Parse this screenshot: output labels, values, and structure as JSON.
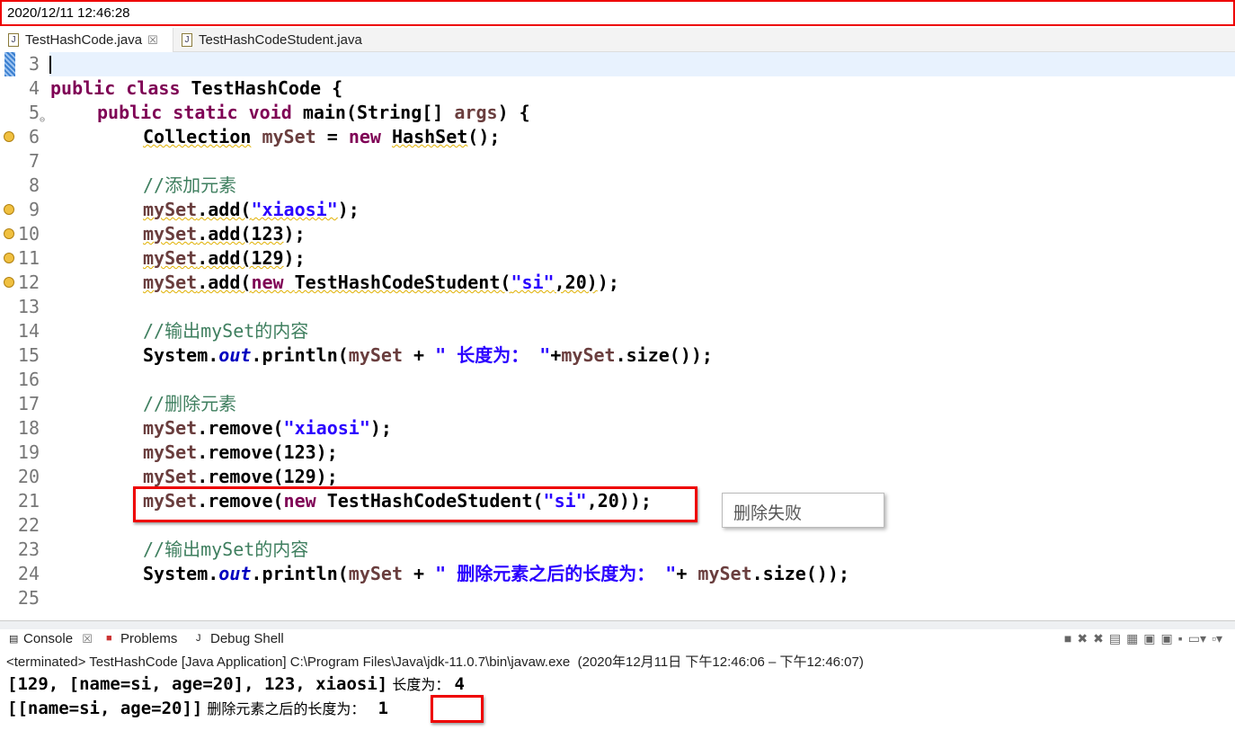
{
  "timestamp": "2020/12/11 12:46:28",
  "editor_tabs": [
    {
      "label": "TestHashCode.java",
      "close": "☒"
    },
    {
      "label": "TestHashCodeStudent.java"
    }
  ],
  "code_lines": [
    {
      "n": "3",
      "indent": 0,
      "tokens": []
    },
    {
      "n": "4",
      "indent": 0,
      "tokens": [
        [
          "kw",
          "public "
        ],
        [
          "kw",
          "class "
        ],
        [
          "pl",
          "TestHashCode {"
        ]
      ]
    },
    {
      "n": "5",
      "indent": 1,
      "fold": true,
      "tokens": [
        [
          "kw",
          "public "
        ],
        [
          "kw",
          "static "
        ],
        [
          "kw",
          "void "
        ],
        [
          "pl",
          "main(String[] "
        ],
        [
          "lv",
          "args"
        ],
        [
          "pl",
          ") {"
        ]
      ]
    },
    {
      "n": "6",
      "indent": 2,
      "warn": true,
      "tokens": [
        [
          "pl wavy",
          "Collection"
        ],
        [
          "pl",
          " "
        ],
        [
          "lv",
          "mySet"
        ],
        [
          "pl",
          " = "
        ],
        [
          "kw",
          "new "
        ],
        [
          "pl wavy",
          "HashSet"
        ],
        [
          "pl",
          "();"
        ]
      ]
    },
    {
      "n": "7",
      "indent": 0,
      "tokens": []
    },
    {
      "n": "8",
      "indent": 2,
      "tokens": [
        [
          "cm",
          "//添加元素"
        ]
      ]
    },
    {
      "n": "9",
      "indent": 2,
      "warn": true,
      "tokens": [
        [
          "lv wavy",
          "mySet"
        ],
        [
          "pl wavy",
          ".add("
        ],
        [
          "str wavy",
          "\"xiaosi\""
        ],
        [
          "pl",
          ");"
        ]
      ]
    },
    {
      "n": "10",
      "indent": 2,
      "warn": true,
      "tokens": [
        [
          "lv wavy",
          "mySet"
        ],
        [
          "pl wavy",
          ".add(123"
        ],
        [
          "pl",
          ");"
        ]
      ]
    },
    {
      "n": "11",
      "indent": 2,
      "warn": true,
      "tokens": [
        [
          "lv wavy",
          "mySet"
        ],
        [
          "pl wavy",
          ".add(129"
        ],
        [
          "pl",
          ");"
        ]
      ]
    },
    {
      "n": "12",
      "indent": 2,
      "warn": true,
      "tokens": [
        [
          "lv wavy",
          "mySet"
        ],
        [
          "pl wavy",
          ".add("
        ],
        [
          "kw wavy",
          "new "
        ],
        [
          "pl wavy",
          "TestHashCodeStudent("
        ],
        [
          "str wavy",
          "\"si\""
        ],
        [
          "pl wavy",
          ",20)"
        ],
        [
          "pl",
          ");"
        ]
      ]
    },
    {
      "n": "13",
      "indent": 0,
      "tokens": []
    },
    {
      "n": "14",
      "indent": 2,
      "tokens": [
        [
          "cm",
          "//输出mySet的内容"
        ]
      ]
    },
    {
      "n": "15",
      "indent": 2,
      "tokens": [
        [
          "pl",
          "System."
        ],
        [
          "fd",
          "out"
        ],
        [
          "pl",
          ".println("
        ],
        [
          "lv",
          "mySet"
        ],
        [
          "pl",
          " + "
        ],
        [
          "str",
          "\" 长度为： \""
        ],
        [
          "pl",
          "+"
        ],
        [
          "lv",
          "mySet"
        ],
        [
          "pl",
          ".size());"
        ]
      ]
    },
    {
      "n": "16",
      "indent": 0,
      "tokens": []
    },
    {
      "n": "17",
      "indent": 2,
      "tokens": [
        [
          "cm",
          "//删除元素"
        ]
      ]
    },
    {
      "n": "18",
      "indent": 2,
      "tokens": [
        [
          "lv",
          "mySet"
        ],
        [
          "pl",
          ".remove("
        ],
        [
          "str",
          "\"xiaosi\""
        ],
        [
          "pl",
          ");"
        ]
      ]
    },
    {
      "n": "19",
      "indent": 2,
      "tokens": [
        [
          "lv",
          "mySet"
        ],
        [
          "pl",
          ".remove(123);"
        ]
      ]
    },
    {
      "n": "20",
      "indent": 2,
      "tokens": [
        [
          "lv",
          "mySet"
        ],
        [
          "pl",
          ".remove(129);"
        ]
      ]
    },
    {
      "n": "21",
      "indent": 2,
      "tokens": [
        [
          "lv",
          "mySet"
        ],
        [
          "pl",
          ".remove("
        ],
        [
          "kw",
          "new "
        ],
        [
          "pl",
          "TestHashCodeStudent("
        ],
        [
          "str",
          "\"si\""
        ],
        [
          "pl",
          ",20));"
        ]
      ]
    },
    {
      "n": "22",
      "indent": 0,
      "tokens": []
    },
    {
      "n": "23",
      "indent": 2,
      "tokens": [
        [
          "cm",
          "//输出mySet的内容"
        ]
      ]
    },
    {
      "n": "24",
      "indent": 2,
      "tokens": [
        [
          "pl",
          "System."
        ],
        [
          "fd",
          "out"
        ],
        [
          "pl",
          ".println("
        ],
        [
          "lv",
          "mySet"
        ],
        [
          "pl",
          " + "
        ],
        [
          "str",
          "\" 删除元素之后的长度为： \""
        ],
        [
          "pl",
          "+ "
        ],
        [
          "lv",
          "mySet"
        ],
        [
          "pl",
          ".size());"
        ]
      ]
    },
    {
      "n": "25",
      "indent": 0,
      "tokens": []
    }
  ],
  "annotation": "删除失败",
  "console": {
    "tabs": [
      "Console",
      "Problems",
      "Debug Shell"
    ],
    "close": "☒",
    "info": "<terminated> TestHashCode [Java Application] C:\\Program Files\\Java\\jdk-11.0.7\\bin\\javaw.exe  (2020年12月11日 下午12:46:06 – 下午12:46:07)",
    "line1_code": "[129, [name=si, age=20], 123, xiaosi]",
    "line1_label": " 长度为： ",
    "line1_value": "4",
    "line2_code": "[[name=si, age=20]]",
    "line2_label": " 删除元素之后的长度为：",
    "line2_value": "1"
  },
  "icons": [
    "terminate-icon",
    "remove-launch-icon",
    "remove-all-icon",
    "scroll-lock-icon",
    "word-wrap-icon",
    "show-stdout-icon",
    "show-stderr-icon",
    "pin-icon",
    "display-console-icon",
    "new-console-icon"
  ],
  "colors": {
    "keyword": "#7f0055",
    "string": "#2a00ff",
    "comment": "#3f7f5f",
    "highlight": "#e00000"
  }
}
